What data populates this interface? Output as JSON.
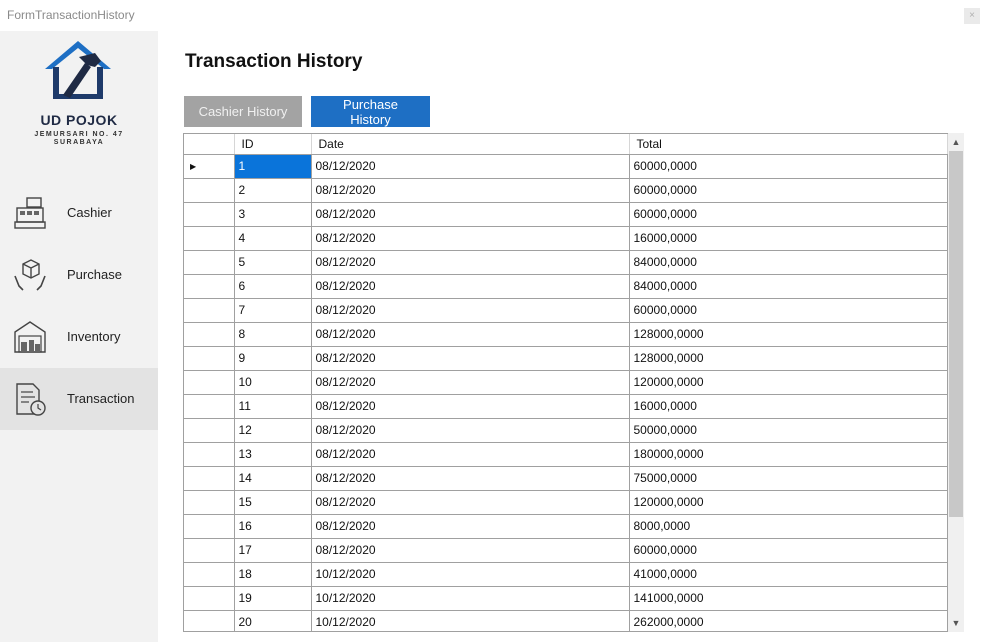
{
  "window": {
    "title": "FormTransactionHistory",
    "close_label": "×"
  },
  "brand": {
    "name": "UD POJOK",
    "address_line1": "JEMURSARI NO. 47",
    "address_line2": "SURABAYA",
    "logo_color": "#1e6fc4"
  },
  "nav": {
    "items": [
      {
        "label": "Cashier",
        "icon": "cash-register-icon"
      },
      {
        "label": "Purchase",
        "icon": "purchase-box-icon"
      },
      {
        "label": "Inventory",
        "icon": "warehouse-icon"
      },
      {
        "label": "Transaction",
        "icon": "document-clock-icon",
        "active": true
      }
    ]
  },
  "main": {
    "title": "Transaction History",
    "buttons": {
      "cashier_history": "Cashier History",
      "purchase_history": "Purchase History"
    },
    "table": {
      "columns": [
        "ID",
        "Date",
        "Total"
      ],
      "rows": [
        [
          "1",
          "08/12/2020",
          "60000,0000"
        ],
        [
          "2",
          "08/12/2020",
          "60000,0000"
        ],
        [
          "3",
          "08/12/2020",
          "60000,0000"
        ],
        [
          "4",
          "08/12/2020",
          "16000,0000"
        ],
        [
          "5",
          "08/12/2020",
          "84000,0000"
        ],
        [
          "6",
          "08/12/2020",
          "84000,0000"
        ],
        [
          "7",
          "08/12/2020",
          "60000,0000"
        ],
        [
          "8",
          "08/12/2020",
          "128000,0000"
        ],
        [
          "9",
          "08/12/2020",
          "128000,0000"
        ],
        [
          "10",
          "08/12/2020",
          "120000,0000"
        ],
        [
          "11",
          "08/12/2020",
          "16000,0000"
        ],
        [
          "12",
          "08/12/2020",
          "50000,0000"
        ],
        [
          "13",
          "08/12/2020",
          "180000,0000"
        ],
        [
          "14",
          "08/12/2020",
          "75000,0000"
        ],
        [
          "15",
          "08/12/2020",
          "120000,0000"
        ],
        [
          "16",
          "08/12/2020",
          "8000,0000"
        ],
        [
          "17",
          "08/12/2020",
          "60000,0000"
        ],
        [
          "18",
          "10/12/2020",
          "41000,0000"
        ],
        [
          "19",
          "10/12/2020",
          "141000,0000"
        ],
        [
          "20",
          "10/12/2020",
          "262000,0000"
        ]
      ],
      "current_row_marker": "▶",
      "selected_row": 0
    },
    "scroll": {
      "up": "▲",
      "down": "▼"
    }
  }
}
